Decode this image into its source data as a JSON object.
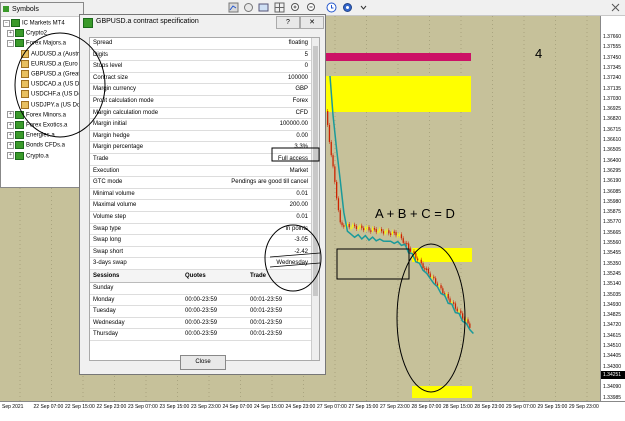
{
  "symbols_window": {
    "title": "Symbols",
    "items": [
      {
        "label": "IC Markets MT4",
        "kind": "root"
      },
      {
        "label": "Crypto2",
        "kind": "folder"
      },
      {
        "label": "Forex Majors.a",
        "kind": "folder"
      },
      {
        "label": "AUDUSD.a (Austr",
        "kind": "symbol"
      },
      {
        "label": "EURUSD.a (Euro v",
        "kind": "symbol"
      },
      {
        "label": "GBPUSD.a (Great E",
        "kind": "symbol"
      },
      {
        "label": "USDCAD.a (US Do",
        "kind": "symbol"
      },
      {
        "label": "USDCHF.a (US Do",
        "kind": "symbol"
      },
      {
        "label": "USDJPY.a (US Doll",
        "kind": "symbol"
      },
      {
        "label": "Forex Minors.a",
        "kind": "folder"
      },
      {
        "label": "Forex Exotics.a",
        "kind": "folder"
      },
      {
        "label": "Energies.a",
        "kind": "folder"
      },
      {
        "label": "Bonds CFDs.a",
        "kind": "folder"
      },
      {
        "label": "Crypto.a",
        "kind": "folder"
      }
    ]
  },
  "dialog": {
    "title": "GBPUSD.a contract specification",
    "help_label": "?",
    "close_x": "✕",
    "close_button": "Close",
    "specs": [
      {
        "k": "Spread",
        "v": "floating"
      },
      {
        "k": "Digits",
        "v": "5"
      },
      {
        "k": "Stops level",
        "v": "0"
      },
      {
        "k": "Contract size",
        "v": "100000"
      },
      {
        "k": "Margin currency",
        "v": "GBP"
      },
      {
        "k": "Profit calculation mode",
        "v": "Forex"
      },
      {
        "k": "Margin calculation mode",
        "v": "CFD"
      },
      {
        "k": "Margin initial",
        "v": "100000.00"
      },
      {
        "k": "Margin hedge",
        "v": "0.00"
      },
      {
        "k": "Margin percentage",
        "v": "3.3%"
      },
      {
        "k": "Trade",
        "v": "Full access"
      },
      {
        "k": "Execution",
        "v": "Market"
      },
      {
        "k": "GTC mode",
        "v": "Pendings are good till cancel"
      },
      {
        "k": "Minimal volume",
        "v": "0.01"
      },
      {
        "k": "Maximal volume",
        "v": "200.00"
      },
      {
        "k": "Volume step",
        "v": "0.01"
      },
      {
        "k": "Swap type",
        "v": "in points"
      },
      {
        "k": "Swap long",
        "v": "-3.05"
      },
      {
        "k": "Swap short",
        "v": "-2.42"
      },
      {
        "k": "3-days swap",
        "v": "Wednesday"
      }
    ],
    "sessions_header": {
      "sessions": "Sessions",
      "quotes": "Quotes",
      "trade": "Trade"
    },
    "sessions": [
      {
        "day": "Sunday",
        "quotes": "",
        "trade": ""
      },
      {
        "day": "Monday",
        "quotes": "00:00-23:59",
        "trade": "00:01-23:59"
      },
      {
        "day": "Tuesday",
        "quotes": "00:00-23:59",
        "trade": "00:01-23:59"
      },
      {
        "day": "Wednesday",
        "quotes": "00:00-23:59",
        "trade": "00:01-23:59"
      },
      {
        "day": "Thursday",
        "quotes": "00:00-23:59",
        "trade": "00:01-23:59"
      }
    ]
  },
  "chart": {
    "annotation_number": "4",
    "formula": "A + B + C = D",
    "price_labels": [
      "1.37660",
      "1.37555",
      "1.37450",
      "1.37345",
      "1.37240",
      "1.37135",
      "1.37030",
      "1.36925",
      "1.36820",
      "1.36715",
      "1.36610",
      "1.36505",
      "1.36400",
      "1.36295",
      "1.36190",
      "1.36085",
      "1.35980",
      "1.35875",
      "1.35770",
      "1.35665",
      "1.35560",
      "1.35455",
      "1.35350",
      "1.35245",
      "1.35140",
      "1.35035",
      "1.34930",
      "1.34825",
      "1.34720",
      "1.34615",
      "1.34510",
      "1.34405",
      "1.34300",
      "1.34195",
      "1.34090",
      "1.33985"
    ],
    "current_price": "1.34251",
    "time_labels": [
      "Sep 2021",
      "22 Sep 07:00",
      "22 Sep 15:00",
      "22 Sep 23:00",
      "23 Sep 07:00",
      "23 Sep 15:00",
      "23 Sep 23:00",
      "24 Sep 07:00",
      "24 Sep 15:00",
      "24 Sep 23:00",
      "27 Sep 07:00",
      "27 Sep 15:00",
      "27 Sep 23:00",
      "28 Sep 07:00",
      "28 Sep 15:00",
      "28 Sep 23:00",
      "29 Sep 07:00",
      "29 Sep 15:00",
      "29 Sep 23:00"
    ],
    "colors": {
      "bg": "#c6c19a",
      "bull": "#ffff00",
      "bear": "#cc2200",
      "ma": "#1a9a9a",
      "zone_yellow": "#ffff00",
      "zone_magenta": "#cc1166"
    }
  }
}
